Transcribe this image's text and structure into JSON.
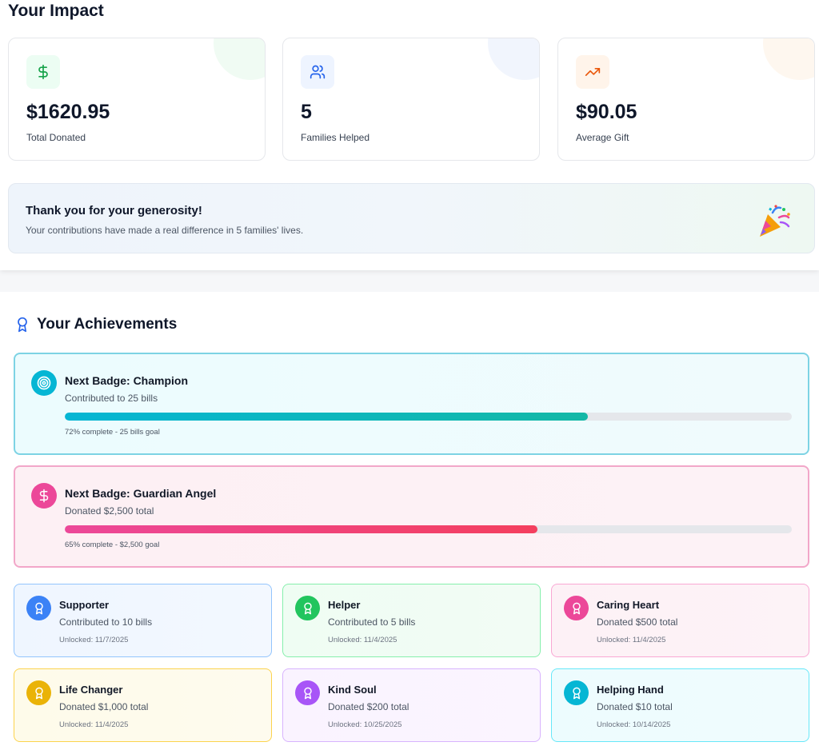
{
  "impact": {
    "title": "Your Impact",
    "stats": [
      {
        "value": "$1620.95",
        "label": "Total Donated",
        "icon": "dollar-icon",
        "color": "#16a34a"
      },
      {
        "value": "5",
        "label": "Families Helped",
        "icon": "users-icon",
        "color": "#2563eb"
      },
      {
        "value": "$90.05",
        "label": "Average Gift",
        "icon": "trending-up-icon",
        "color": "#ea580c"
      }
    ],
    "thanks": {
      "title": "Thank you for your generosity!",
      "text": "Your contributions have made a real difference in 5 families' lives.",
      "icon": "party-popper-icon"
    }
  },
  "achievements": {
    "title": "Your Achievements",
    "icon": "award-icon",
    "next_badges": [
      {
        "title": "Next Badge: Champion",
        "description": "Contributed to 25 bills",
        "progress_percent": 72,
        "note": "72% complete - 25 bills goal",
        "icon": "target-icon",
        "color": "#06b6d4"
      },
      {
        "title": "Next Badge: Guardian Angel",
        "description": "Donated $2,500 total",
        "progress_percent": 65,
        "note": "65% complete - $2,500 goal",
        "icon": "dollar-icon",
        "color": "#ec4899"
      }
    ],
    "unlocked": [
      {
        "title": "Supporter",
        "description": "Contributed to 10 bills",
        "date": "Unlocked: 11/7/2025",
        "color": "#3b82f6",
        "icon": "award-icon"
      },
      {
        "title": "Helper",
        "description": "Contributed to 5 bills",
        "date": "Unlocked: 11/4/2025",
        "color": "#22c55e",
        "icon": "award-icon"
      },
      {
        "title": "Caring Heart",
        "description": "Donated $500 total",
        "date": "Unlocked: 11/4/2025",
        "color": "#ec4899",
        "icon": "award-icon"
      },
      {
        "title": "Life Changer",
        "description": "Donated $1,000 total",
        "date": "Unlocked: 11/4/2025",
        "color": "#eab308",
        "icon": "award-icon"
      },
      {
        "title": "Kind Soul",
        "description": "Donated $200 total",
        "date": "Unlocked: 10/25/2025",
        "color": "#a855f7",
        "icon": "award-icon"
      },
      {
        "title": "Helping Hand",
        "description": "Donated $10 total",
        "date": "Unlocked: 10/14/2025",
        "color": "#06b6d4",
        "icon": "award-icon"
      }
    ]
  }
}
